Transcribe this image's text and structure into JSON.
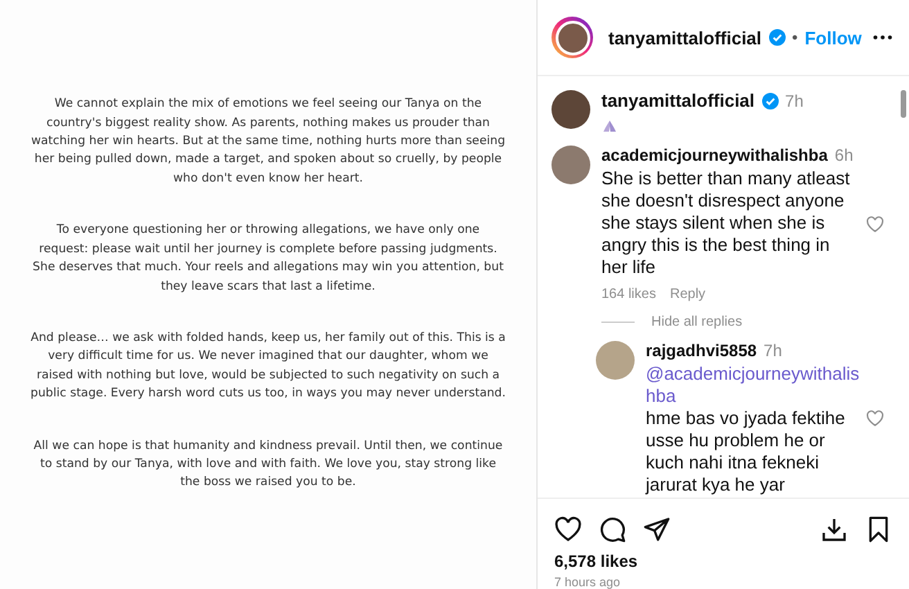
{
  "post": {
    "paragraphs": [
      "We cannot explain the mix of emotions we feel seeing our Tanya on the country's biggest reality show. As parents, nothing makes us prouder than watching her win hearts. But at the same time, nothing hurts more than seeing her being pulled down, made a target, and spoken about so cruelly, by people who don't even know her heart.",
      "To everyone questioning her or throwing allegations, we have only one request: please wait until her journey is complete before passing judgments. She deserves that much. Your reels and allegations may win you attention, but they leave scars that last a lifetime.",
      "And please… we ask with folded hands, keep us, her family out of this. This is a very difficult time for us. We never imagined that our daughter, whom we raised with nothing but love, would be subjected to such negativity on such a public stage. Every harsh word cuts us too, in ways you may never understand.",
      "All we can hope is that humanity and kindness prevail. Until then, we continue to stand by our Tanya, with love and with faith. We love you, stay strong like the boss we raised you to be."
    ]
  },
  "header": {
    "username": "tanyamittalofficial",
    "verified": true,
    "separator": "•",
    "follow": "Follow"
  },
  "caption": {
    "username": "tanyamittalofficial",
    "verified": true,
    "time": "7h"
  },
  "comments": [
    {
      "username": "academicjourneywithalishba",
      "time": "6h",
      "text": "She is better than many atleast she doesn't disrespect anyone she stays silent when she is angry this is the best thing in her life",
      "likes": "164 likes",
      "reply": "Reply",
      "hide_replies": "Hide all replies",
      "replies": [
        {
          "username": "rajgadhvi5858",
          "time": "7h",
          "mention": "@academicjourneywithalishba",
          "text": "hme bas vo jyada fektihe usse hu problem he or kuch nahi itna fekneki jarurat kya he yar"
        }
      ]
    }
  ],
  "likes": "6,578 likes",
  "time_ago": "7 hours ago"
}
